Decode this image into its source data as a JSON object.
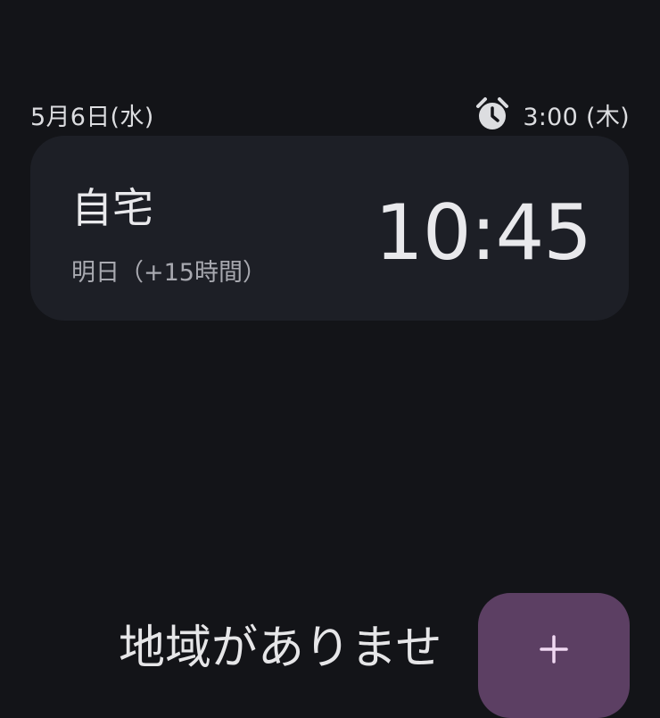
{
  "header": {
    "date": "5月6日(水)",
    "alarm_icon": "alarm-clock-icon",
    "next_alarm": "3:00 (木)"
  },
  "world_clocks": [
    {
      "city": "自宅",
      "offset": "明日（+15時間）",
      "time": "10:45"
    }
  ],
  "empty_state": {
    "message": "地域がありませ"
  },
  "fab": {
    "icon": "plus-icon",
    "color": "#5c3f63"
  },
  "colors": {
    "background": "#131418",
    "card": "#1d1f26",
    "fab": "#5c3f63"
  }
}
